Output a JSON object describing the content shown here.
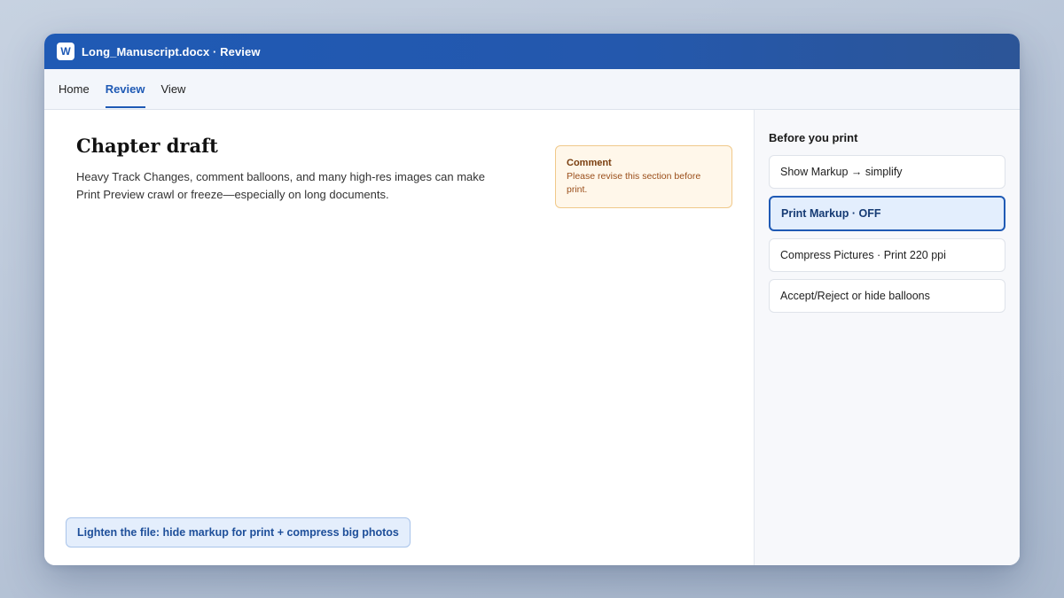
{
  "window": {
    "app_icon_letter": "W",
    "title": "Long_Manuscript.docx · Review"
  },
  "ribbon": {
    "tabs": [
      {
        "label": "Home"
      },
      {
        "label": "Review",
        "active": true
      },
      {
        "label": "View"
      }
    ]
  },
  "document": {
    "heading": "Chapter draft",
    "body": "Heavy Track Changes, comment balloons, and many high-res images can make Print Preview crawl or freeze—especially on long documents.",
    "comment": {
      "label": "Comment",
      "text": "Please revise this section before print."
    },
    "tip_button": "Lighten the file: hide markup for print + compress big photos"
  },
  "sidebar": {
    "title": "Before you print",
    "options": [
      {
        "label": "Show Markup → simplify",
        "selected": false
      },
      {
        "label": "Print Markup · OFF",
        "selected": true
      },
      {
        "label": "Compress Pictures · Print 220 ppi",
        "selected": false
      },
      {
        "label": "Accept/Reject or hide balloons",
        "selected": false
      }
    ]
  },
  "colors": {
    "accent": "#1f5ab5",
    "comment_bg": "#fff7ea",
    "comment_border": "#f0c98a"
  }
}
